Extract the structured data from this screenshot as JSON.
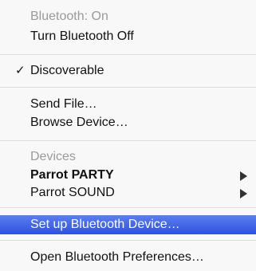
{
  "menu": {
    "status": "Bluetooth: On",
    "turn_off": "Turn Bluetooth Off",
    "discoverable": "Discoverable",
    "discoverable_check": "✓",
    "send_file": "Send File…",
    "browse_device": "Browse Device…",
    "devices_header": "Devices",
    "devices": [
      {
        "label": "Parrot PARTY",
        "bold": true
      },
      {
        "label": "Parrot SOUND",
        "bold": false
      }
    ],
    "setup": "Set up Bluetooth Device…",
    "open_prefs": "Open Bluetooth Preferences…"
  },
  "colors": {
    "highlight": "#3a62e6",
    "disabled_text": "#9a9a9a",
    "menu_background": "#f8f8f8"
  },
  "icons": {
    "checkmark": "checkmark-icon",
    "submenu": "submenu-arrow-icon"
  }
}
